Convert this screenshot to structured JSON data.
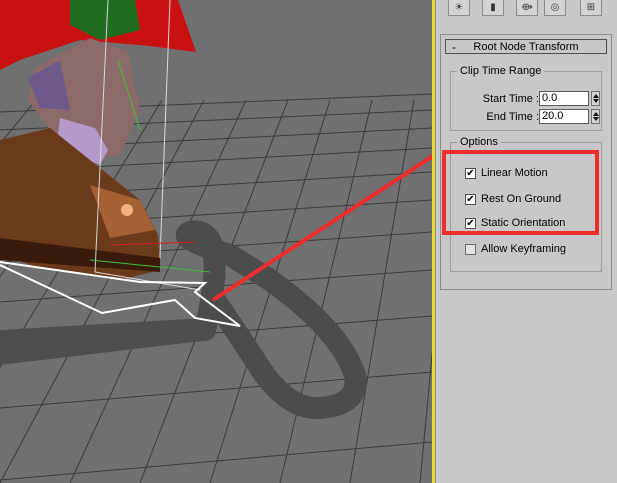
{
  "command_panel": {
    "tabs": [
      {
        "icon": "create-icon",
        "glyph": "☀"
      },
      {
        "icon": "modify-icon",
        "glyph": "▮"
      },
      {
        "icon": "hierarchy-icon",
        "glyph": "⟴"
      },
      {
        "icon": "motion-icon",
        "glyph": "◎"
      },
      {
        "icon": "display-icon",
        "glyph": "⊞"
      }
    ]
  },
  "rollout": {
    "collapse_symbol": "-",
    "title": "Root Node Transform",
    "clip_time_range": {
      "legend": "Clip Time Range",
      "start_time": {
        "label": "Start Time :",
        "value": "0.0"
      },
      "end_time": {
        "label": "End Time :",
        "value": "20.0"
      }
    },
    "options": {
      "legend": "Options",
      "linear_motion": {
        "label": "Linear Motion",
        "checked": true,
        "mark": "✔"
      },
      "rest_on_ground": {
        "label": "Rest On Ground",
        "checked": true,
        "mark": "✔"
      },
      "static_orientation": {
        "label": "Static Orientation",
        "checked": true,
        "mark": "✔"
      },
      "allow_keyframing": {
        "label": "Allow Keyframing",
        "checked": false,
        "mark": ""
      }
    }
  },
  "annotation": {
    "color": "#ef2d2d"
  },
  "viewport": {
    "background": "#6e6e6e",
    "grid_color": "#3a3a3a",
    "path_shadow_color": "#4a4a4a",
    "boot_color": "#6b3a1a",
    "hat_color": "#c81010"
  }
}
